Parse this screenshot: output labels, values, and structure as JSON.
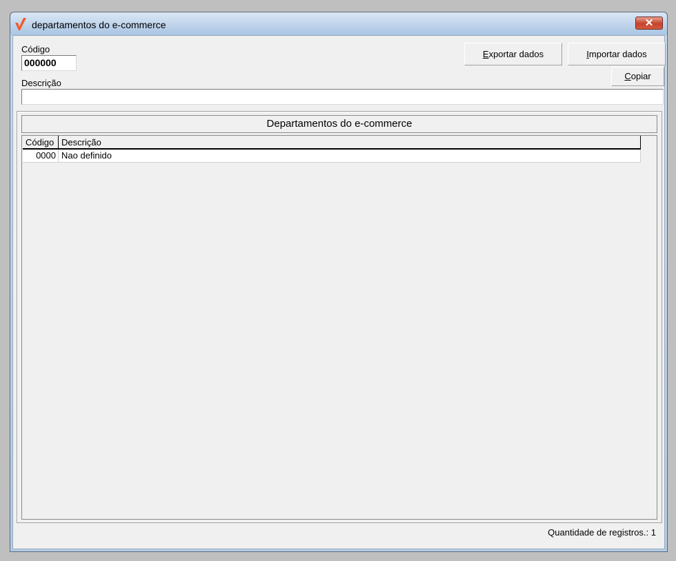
{
  "window": {
    "title": "departamentos do e-commerce",
    "close_label": "✕"
  },
  "form": {
    "codigo_label": "Código",
    "codigo_value": "000000",
    "descricao_label": "Descrição",
    "descricao_value": ""
  },
  "buttons": {
    "exportar": {
      "key": "E",
      "rest": "xportar dados"
    },
    "importar": {
      "key": "I",
      "rest": "mportar dados"
    },
    "copiar": {
      "key": "C",
      "rest": "opiar"
    }
  },
  "panel": {
    "title": "Departamentos do e-commerce"
  },
  "table": {
    "columns": [
      "Código",
      "Descrição"
    ],
    "rows": [
      {
        "codigo": "0000",
        "descricao": "Nao definido"
      }
    ]
  },
  "status": {
    "count_text": "Quantidade de registros.: 1"
  },
  "colors": {
    "accent": "#f05a28",
    "background": "#f0f0f0"
  }
}
